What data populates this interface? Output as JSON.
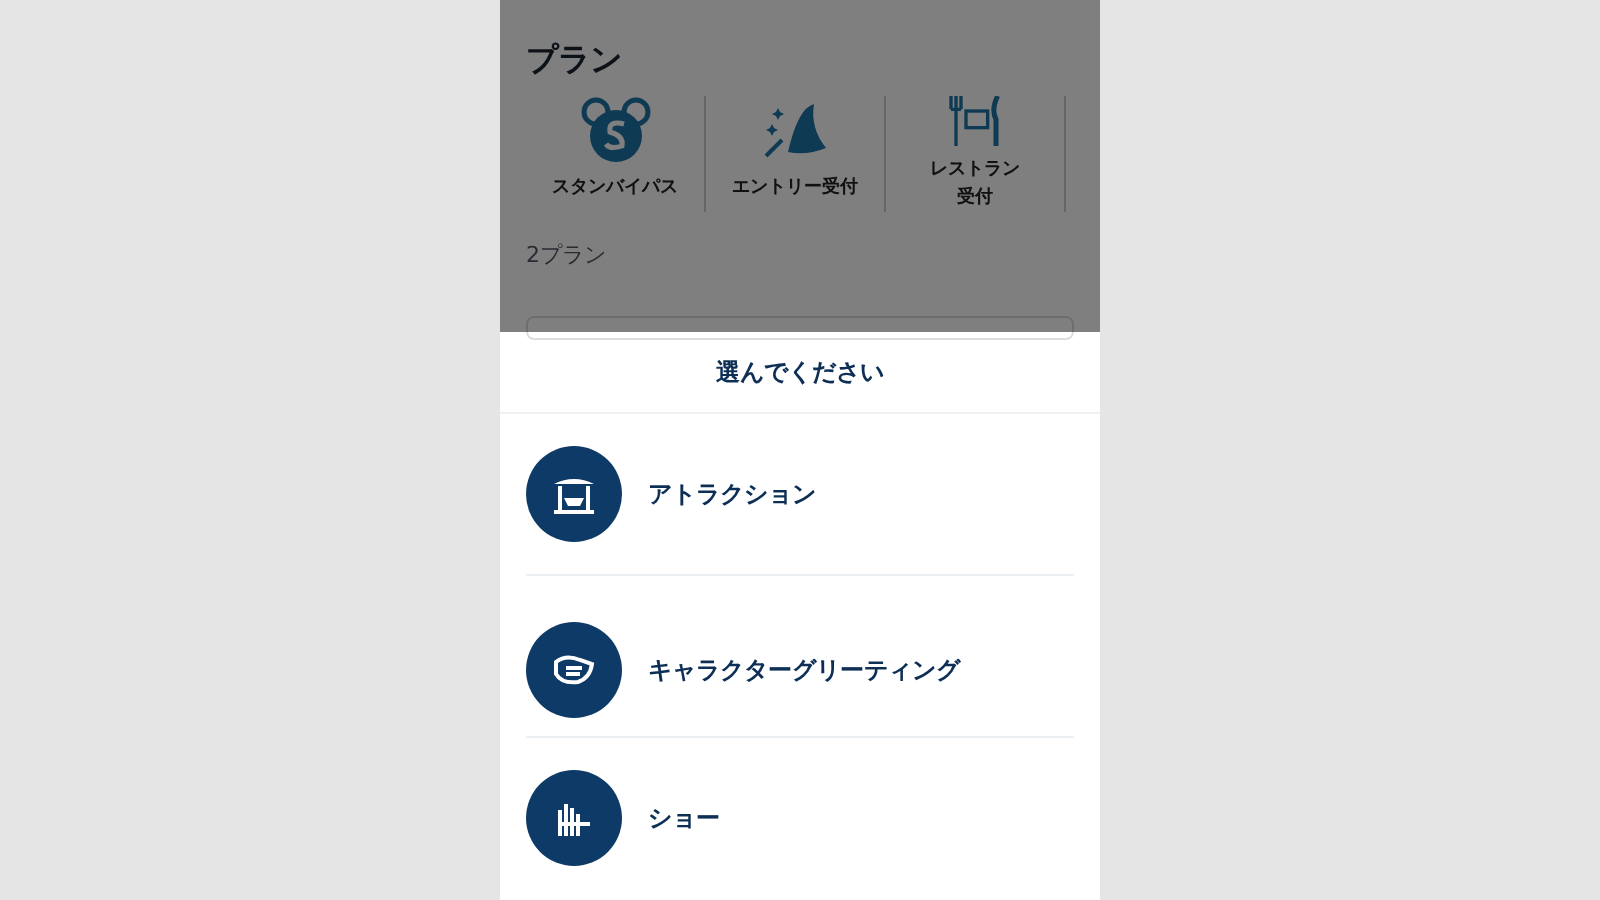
{
  "plan": {
    "title": "プラン",
    "features": [
      {
        "kind": "standby",
        "lines": [
          "スタンバイパス"
        ]
      },
      {
        "kind": "entry",
        "lines": [
          "エントリー受付"
        ]
      },
      {
        "kind": "restaurant",
        "lines": [
          "レストラン",
          "受付"
        ]
      }
    ],
    "subtitle": "2プラン"
  },
  "sheet": {
    "title": "選んでください",
    "options": [
      {
        "kind": "attraction",
        "label": "アトラクション"
      },
      {
        "kind": "greeting",
        "label": "キャラクターグリーティング"
      },
      {
        "kind": "show",
        "label": "ショー"
      }
    ]
  }
}
